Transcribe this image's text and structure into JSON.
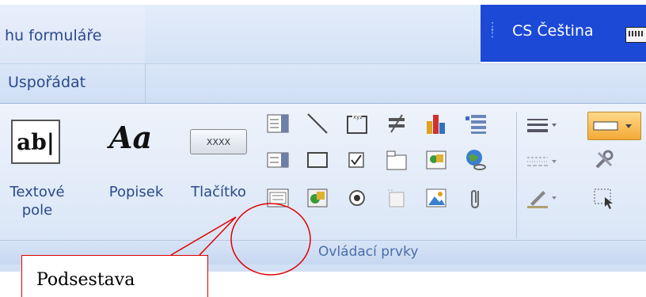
{
  "tabs": {
    "left_tab_label": "hu formuláře",
    "arrange_tab_label": "Uspořádat"
  },
  "language": {
    "label": "CS Čeština"
  },
  "ribbon": {
    "big_buttons": [
      {
        "icon_text": "ab|",
        "label_line1": "Textové",
        "label_line2": "pole"
      },
      {
        "icon_text": "Aa",
        "label_line1": "Popisek",
        "label_line2": ""
      },
      {
        "icon_text": "XXXX",
        "label_line1": "Tlačítko",
        "label_line2": ""
      }
    ],
    "group_label": "Ovládací prvky",
    "small_icons": [
      "combo-box-icon",
      "line-icon",
      "option-group-icon",
      "toggle-button-icon",
      "chart-icon",
      "list-box-icon",
      "list-icon",
      "rectangle-icon",
      "checkbox-icon",
      "tab-control-icon",
      "bound-object-frame-icon",
      "hyperlink-icon",
      "subform-icon",
      "unbound-object-frame-icon",
      "option-button-icon",
      "page-break-icon",
      "image-icon",
      "attachment-icon"
    ]
  },
  "annotation": {
    "text": "Podsestava"
  }
}
